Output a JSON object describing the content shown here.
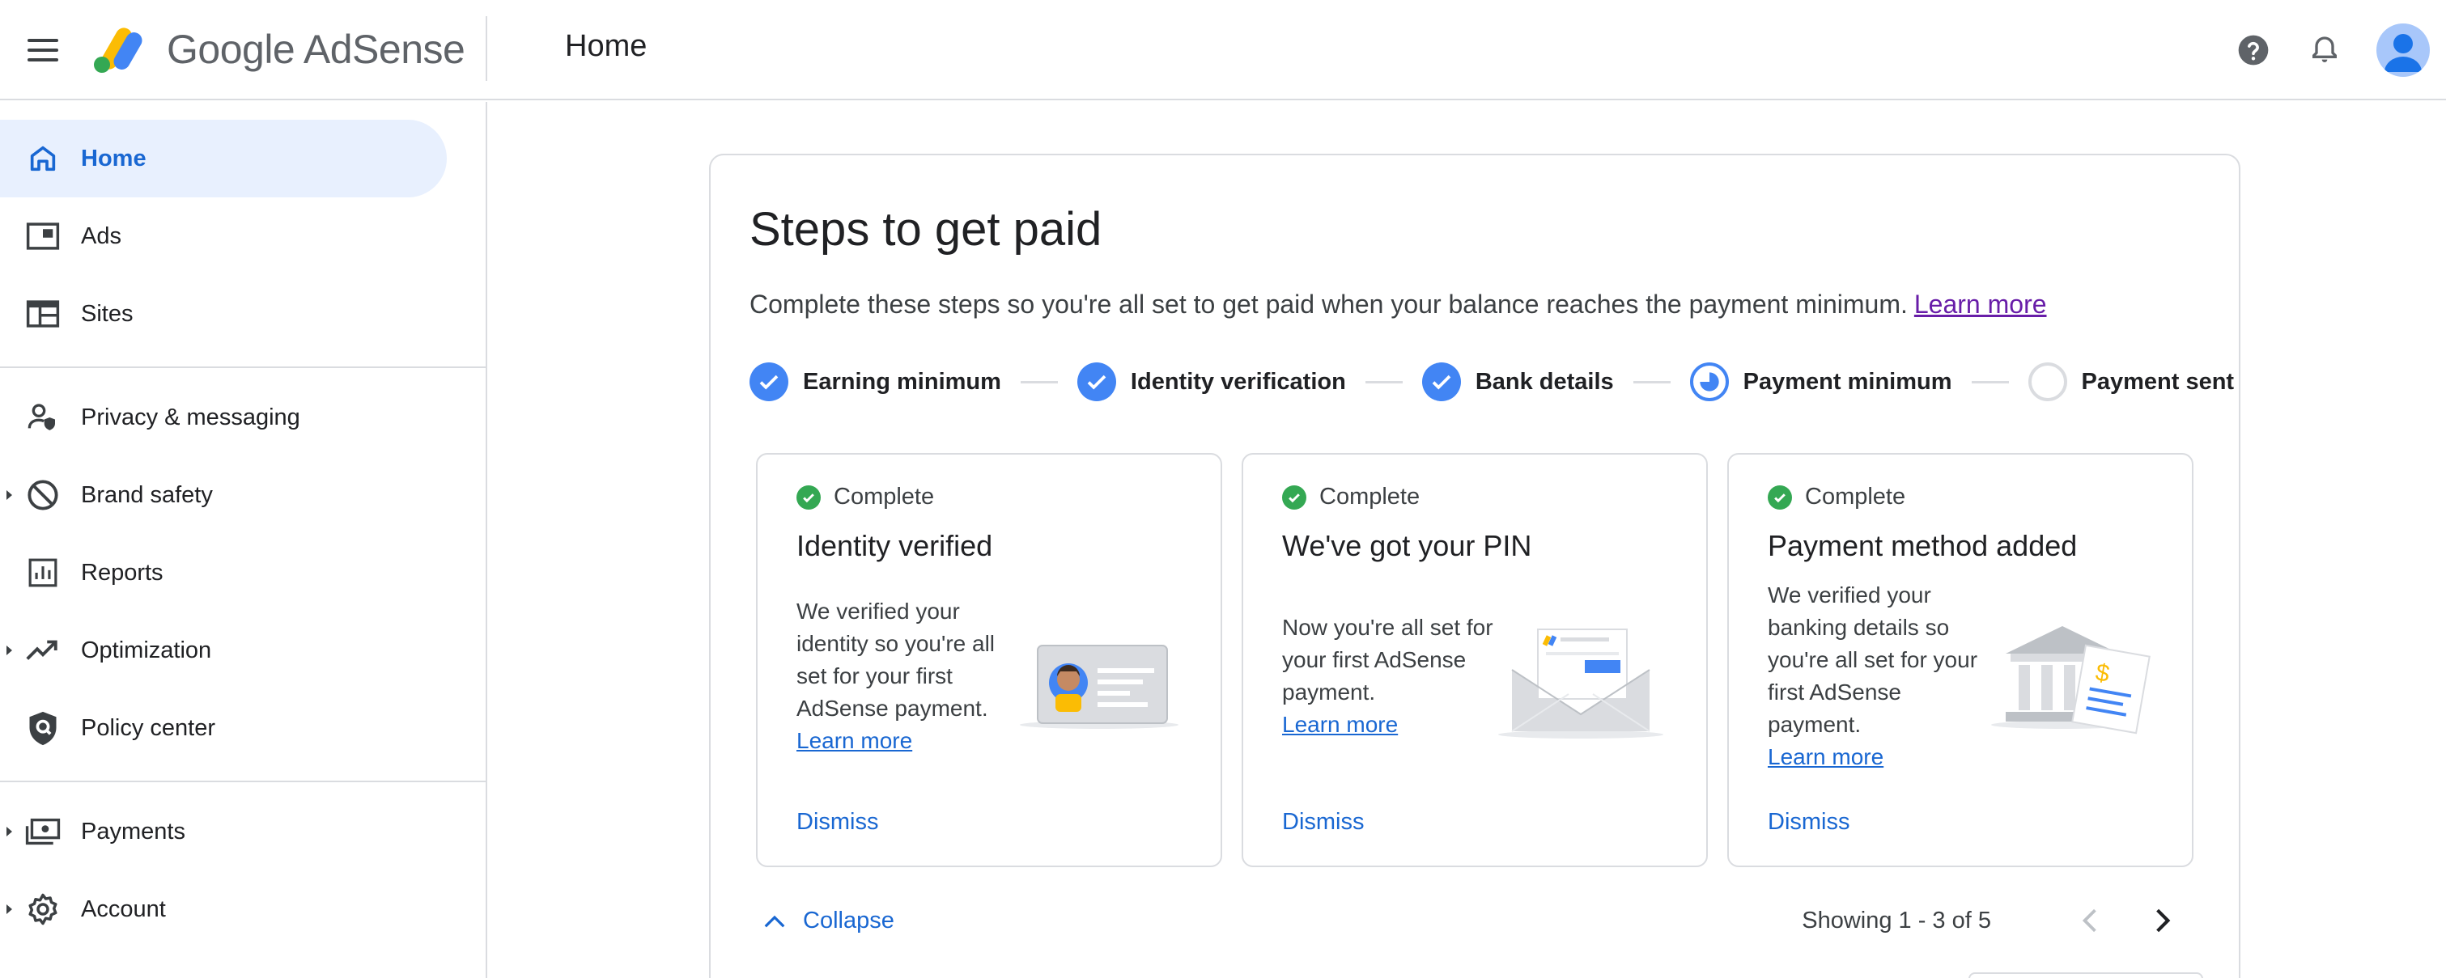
{
  "app": {
    "name_google": "Google",
    "name_product": "AdSense",
    "page_title": "Home"
  },
  "colors": {
    "accent": "#1967d2",
    "active_bg": "#e8f0fe",
    "step_done": "#4285f4",
    "success": "#34a853",
    "visited_link": "#681da8"
  },
  "topbar": {
    "icons": [
      "menu-icon",
      "help-icon",
      "notifications-icon",
      "account-avatar"
    ]
  },
  "sidebar": {
    "items": [
      {
        "label": "Home",
        "icon": "home-icon",
        "active": true
      },
      {
        "label": "Ads",
        "icon": "ads-icon"
      },
      {
        "label": "Sites",
        "icon": "sites-icon"
      },
      {
        "label": "Privacy & messaging",
        "icon": "privacy-icon"
      },
      {
        "label": "Brand safety",
        "icon": "block-icon",
        "expandable": true
      },
      {
        "label": "Reports",
        "icon": "reports-icon"
      },
      {
        "label": "Optimization",
        "icon": "trending-icon",
        "expandable": true
      },
      {
        "label": "Policy center",
        "icon": "policy-icon"
      },
      {
        "label": "Payments",
        "icon": "payments-icon",
        "expandable": true
      },
      {
        "label": "Account",
        "icon": "gear-icon",
        "expandable": true
      }
    ]
  },
  "steps_card": {
    "title": "Steps to get paid",
    "subtitle": "Complete these steps so you're all set to get paid when your balance reaches the payment minimum.",
    "learn_more": "Learn more",
    "steps": [
      {
        "label": "Earning minimum",
        "state": "done"
      },
      {
        "label": "Identity verification",
        "state": "done"
      },
      {
        "label": "Bank details",
        "state": "done"
      },
      {
        "label": "Payment minimum",
        "state": "in-progress"
      },
      {
        "label": "Payment sent",
        "state": "pending"
      }
    ],
    "cards": [
      {
        "status": "Complete",
        "title": "Identity verified",
        "body": "We verified your identity so you're all set for your first AdSense payment.",
        "link": "Learn more",
        "dismiss": "Dismiss",
        "illustration": "id-card-illustration"
      },
      {
        "status": "Complete",
        "title": "We've got your PIN",
        "body": "Now you're all set for your first AdSense payment.",
        "link": "Learn more",
        "dismiss": "Dismiss",
        "illustration": "envelope-illustration"
      },
      {
        "status": "Complete",
        "title": "Payment method added",
        "body": "We verified your banking details so you're all set for your first AdSense payment.",
        "link": "Learn more",
        "dismiss": "Dismiss",
        "illustration": "bank-illustration"
      }
    ],
    "collapse_label": "Collapse",
    "pager_text": "Showing 1 - 3 of 5"
  }
}
